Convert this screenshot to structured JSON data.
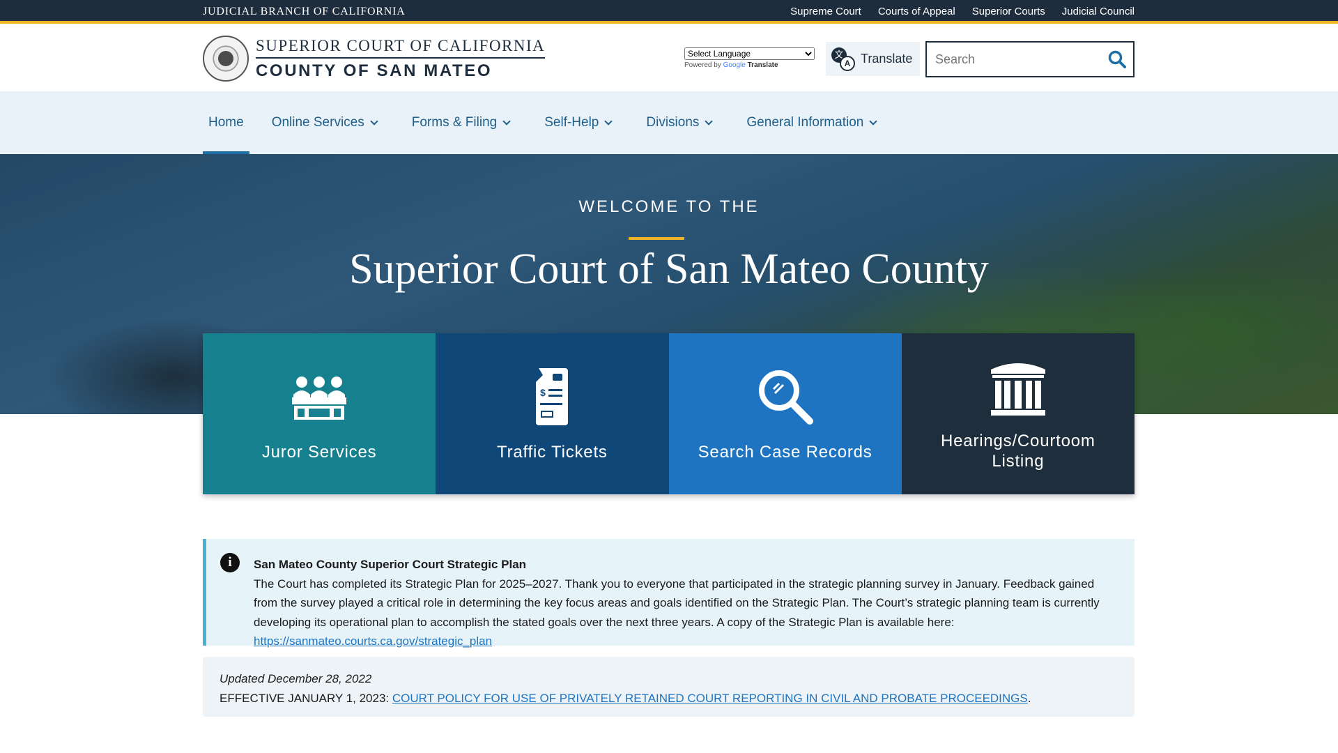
{
  "topbar": {
    "brand": "JUDICIAL BRANCH OF CALIFORNIA",
    "links": [
      "Supreme Court",
      "Courts of Appeal",
      "Superior Courts",
      "Judicial Council"
    ]
  },
  "header": {
    "logo_line1": "SUPERIOR COURT OF CALIFORNIA",
    "logo_line2": "COUNTY OF SAN MATEO",
    "language_select": "Select Language",
    "powered_by": "Powered by",
    "google": "Google",
    "translate_word": "Translate",
    "translate_button": "Translate",
    "search_placeholder": "Search"
  },
  "nav": {
    "items": [
      {
        "label": "Home",
        "active": true
      },
      {
        "label": "Online Services"
      },
      {
        "label": "Forms & Filing"
      },
      {
        "label": "Self-Help"
      },
      {
        "label": "Divisions"
      },
      {
        "label": "General Information"
      }
    ]
  },
  "hero": {
    "kicker": "WELCOME TO THE",
    "title": "Superior Court of San Mateo County"
  },
  "cards": [
    {
      "label": "Juror Services",
      "icon": "jurors-icon",
      "color": "#17808e"
    },
    {
      "label": "Traffic Tickets",
      "icon": "traffic-ticket-icon",
      "color": "#0f4778"
    },
    {
      "label": "Search Case Records",
      "icon": "magnifier-icon",
      "color": "#1e74c0"
    },
    {
      "label": "Hearings/Courtoom Listing",
      "icon": "courthouse-icon",
      "color": "#1f2e3c"
    }
  ],
  "alert": {
    "heading": "San Mateo County Superior Court Strategic Plan",
    "text": "The Court has completed its Strategic Plan for 2025–2027. Thank you to everyone that participated in the strategic planning survey in January. Feedback gained from the survey played a critical role in determining the key focus areas and goals identified on the Strategic Plan. The Court’s strategic planning team is currently developing its operational plan to accomplish the stated goals over the next three years. A copy of the Strategic Plan is available here: ",
    "link": "https://sanmateo.courts.ca.gov/strategic_plan"
  },
  "update": {
    "date": "Updated December 28, 2022",
    "prefix": "EFFECTIVE JANUARY 1, 2023: ",
    "link": "COURT POLICY FOR USE OF PRIVATELY RETAINED COURT REPORTING IN CIVIL AND PROBATE PROCEEDINGS",
    "suffix": "."
  }
}
